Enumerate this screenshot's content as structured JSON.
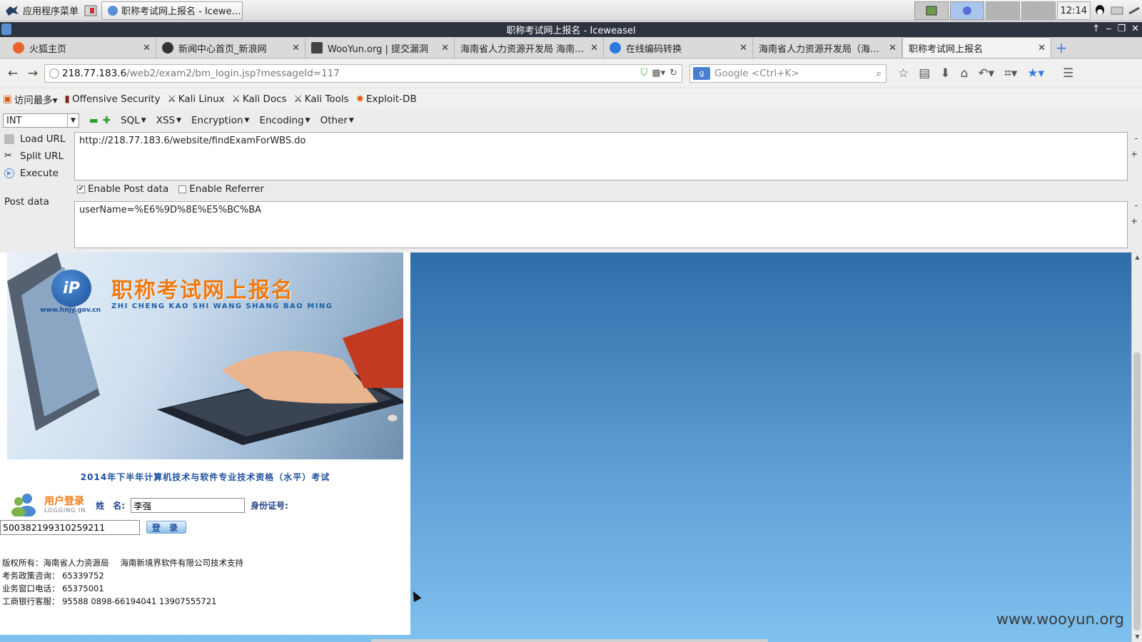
{
  "taskbar": {
    "app_menu_label": "应用程序菜单",
    "active_task_label": "职称考试网上报名 - Icewe…",
    "clock": "12:14"
  },
  "window": {
    "title": "职称考试网上报名 - Iceweasel",
    "controls": [
      "↑",
      "‒",
      "❐",
      "✕"
    ]
  },
  "tabs": [
    {
      "label": "火狐主页",
      "icon": "firefox-icon",
      "color": "#e8662b"
    },
    {
      "label": "新闻中心首页_新浪网",
      "icon": "sina-eye-icon",
      "color": "#333333"
    },
    {
      "label": "WooYun.org | 提交漏洞",
      "icon": "wooyun-icon",
      "color": "#444444"
    },
    {
      "label": "海南省人力资源开发局 海南…",
      "icon": "blank-page-icon",
      "color": "#dddddd"
    },
    {
      "label": "在线编码转换",
      "icon": "c-circle-icon",
      "color": "#2a7ae0"
    },
    {
      "label": "海南省人力资源开发局（海…",
      "icon": "blank-page-icon",
      "color": "#dddddd"
    },
    {
      "label": "职称考试网上报名",
      "icon": "blank-page-icon",
      "color": "#dddddd"
    }
  ],
  "nav": {
    "url_host": "218.77.183.6",
    "url_path": "/web2/exam2/bm_login.jsp?messageId=117",
    "search_placeholder": "Google <Ctrl+K>",
    "search_engine": "g"
  },
  "bookmarks": [
    {
      "label": "访问最多▾",
      "icon": "most-visited-icon"
    },
    {
      "label": "Offensive Security",
      "icon": "offsec-icon"
    },
    {
      "label": "Kali Linux",
      "icon": "kali-dragon-icon"
    },
    {
      "label": "Kali Docs",
      "icon": "kali-dragon-icon"
    },
    {
      "label": "Kali Tools",
      "icon": "kali-dragon-icon"
    },
    {
      "label": "Exploit-DB",
      "icon": "exploitdb-icon"
    }
  ],
  "hackbar": {
    "select_value": "INT",
    "menus": [
      "SQL",
      "XSS",
      "Encryption",
      "Encoding",
      "Other"
    ],
    "load_url": "Load URL",
    "split_url": "Split URL",
    "execute": "Execute",
    "url_value": "http://218.77.183.6/website/findExamForWBS.do",
    "enable_post": "Enable Post data",
    "enable_post_checked": true,
    "enable_referrer": "Enable Referrer",
    "enable_referrer_checked": false,
    "post_label": "Post data",
    "post_value": "userName=%E6%9D%8E%E5%BC%BA",
    "side_minus": "-",
    "side_plus": "+"
  },
  "page": {
    "banner_title": "职称考试网上报名",
    "banner_sub": "ZHI CHENG KAO SHI WANG SHANG BAO MING",
    "banner_url": "www.hnjy.gov.cn",
    "exam_title": "2014年下半年计算机技术与软件专业技术资格（水平）考试",
    "login_cn": "用户登录",
    "login_en": "LOGGING IN",
    "name_label": "姓　名:",
    "name_value": "李强",
    "id_label": "身份证号:",
    "id_value": "500382199310259211",
    "login_button": "登 录",
    "footer": {
      "copyright": "版权所有：海南省人力资源局",
      "support": "海南新境界软件有限公司技术支持",
      "policy": "考务政策咨询：  65339752",
      "window_phone": "业务窗口电话：  65375001",
      "bank": "工商银行客服：  95588    0898-66194041    13907555721"
    }
  },
  "watermark": "www.wooyun.org"
}
